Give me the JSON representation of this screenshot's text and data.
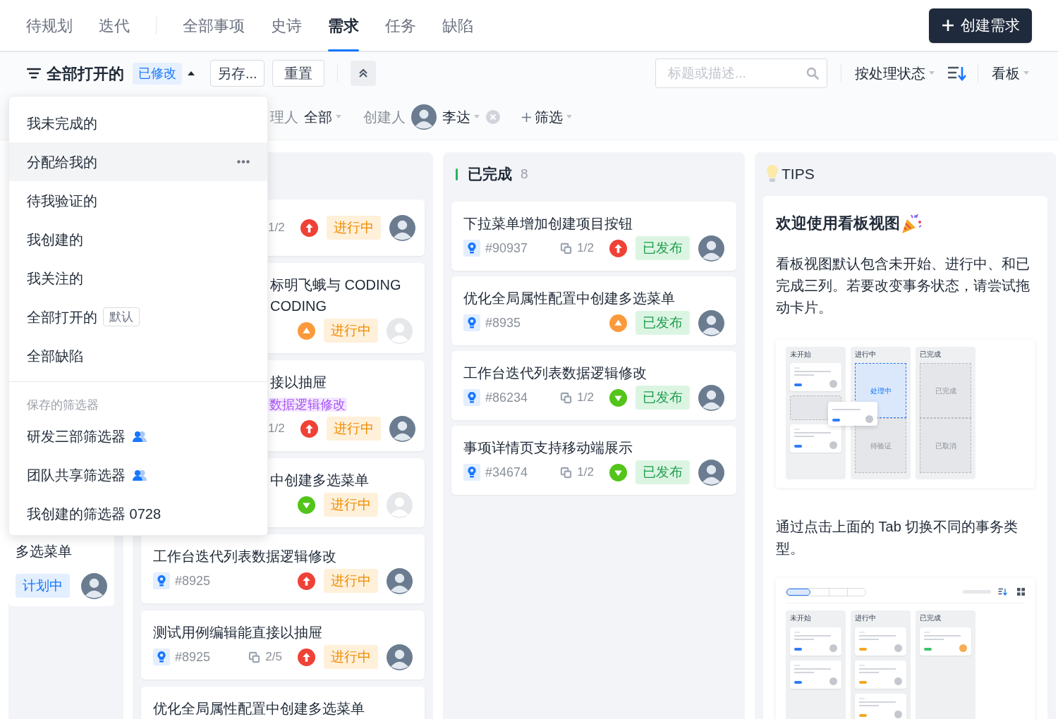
{
  "nav": {
    "tab_groups": [
      [
        {
          "label": "待规划",
          "selected": false
        },
        {
          "label": "迭代",
          "selected": false
        }
      ],
      [
        {
          "label": "全部事项",
          "selected": false
        },
        {
          "label": "史诗",
          "selected": false
        },
        {
          "label": "需求",
          "selected": true
        },
        {
          "label": "任务",
          "selected": false
        },
        {
          "label": "缺陷",
          "selected": false
        }
      ]
    ],
    "create_button": "创建需求"
  },
  "toolbar": {
    "filter_name": "全部打开的",
    "modified_badge": "已修改",
    "save_as": "另存...",
    "reset": "重置",
    "search_placeholder": "标题或描述...",
    "group_by": "按处理状态",
    "view": "看板"
  },
  "filters": [
    {
      "kind": "text",
      "label": "理人",
      "value": "全部"
    },
    {
      "kind": "person",
      "label": "创建人",
      "value": "李达",
      "avatar": {
        "kind": "photo"
      }
    },
    {
      "kind": "add",
      "label": "筛选"
    }
  ],
  "dropdown": {
    "items": [
      {
        "label": "我未完成的",
        "selected": false
      },
      {
        "label": "分配给我的",
        "selected": true
      },
      {
        "label": "待我验证的",
        "selected": false
      },
      {
        "label": "我创建的",
        "selected": false
      },
      {
        "label": "我关注的",
        "selected": false
      },
      {
        "label": "全部打开的",
        "selected": false,
        "tag": "默认"
      },
      {
        "label": "全部缺陷",
        "selected": false
      }
    ],
    "section_title": "保存的筛选器",
    "saved": [
      {
        "label": "研发三部筛选器",
        "shared": true,
        "selected": false
      },
      {
        "label": "团队共享筛选器",
        "shared": true,
        "selected": false
      },
      {
        "label": "我创建的筛选器 0728",
        "shared": false,
        "selected": false
      }
    ]
  },
  "board": {
    "columns": [
      {
        "cards": [
          {
            "title": "多选菜单",
            "status": {
              "label": "计划中",
              "kind": "planned"
            },
            "avatar": {
              "kind": "photo"
            }
          }
        ]
      },
      {
        "cards": [
          {
            "clipped": true,
            "subtasks": "1/2",
            "priority": {
              "kind": "high"
            },
            "status": {
              "label": "进行中",
              "kind": "in_progress"
            },
            "avatar": {
              "kind": "photo"
            }
          },
          {
            "clipped": true,
            "title": "标明飞蛾与 CODING\nCODING",
            "priority": {
              "kind": "medium"
            },
            "status": {
              "label": "进行中",
              "kind": "in_progress"
            },
            "avatar": {
              "kind": "placeholder"
            }
          },
          {
            "clipped": true,
            "title": "接以抽屉",
            "tag": "数据逻辑修改",
            "subtasks": "1/2",
            "priority": {
              "kind": "high"
            },
            "status": {
              "label": "进行中",
              "kind": "in_progress"
            },
            "avatar": {
              "kind": "photo"
            }
          },
          {
            "clipped": true,
            "title": "中创建多选菜单",
            "priority": {
              "kind": "low"
            },
            "status": {
              "label": "进行中",
              "kind": "in_progress"
            },
            "avatar": {
              "kind": "placeholder"
            }
          },
          {
            "clipped": false,
            "title": "工作台迭代列表数据逻辑修改",
            "id": "#8925",
            "priority": {
              "kind": "high"
            },
            "status": {
              "label": "进行中",
              "kind": "in_progress"
            },
            "avatar": {
              "kind": "photo"
            }
          },
          {
            "clipped": false,
            "title": "测试用例编辑能直接以抽屉",
            "id": "#8925",
            "subtasks": "2/5",
            "priority": {
              "kind": "high"
            },
            "status": {
              "label": "进行中",
              "kind": "in_progress"
            },
            "avatar": {
              "kind": "photo"
            }
          },
          {
            "clipped": false,
            "title": "优化全局属性配置中创建多选菜单"
          }
        ]
      },
      {
        "header": {
          "title": "已完成",
          "count": "8"
        },
        "cards": [
          {
            "clipped": false,
            "title": "下拉菜单增加创建项目按钮",
            "id": "#90937",
            "subtasks": "1/2",
            "priority": {
              "kind": "high"
            },
            "status": {
              "label": "已发布",
              "kind": "released"
            },
            "avatar": {
              "kind": "photo"
            }
          },
          {
            "clipped": false,
            "title": "优化全局属性配置中创建多选菜单",
            "id": "#8935",
            "priority": {
              "kind": "medium"
            },
            "status": {
              "label": "已发布",
              "kind": "released"
            },
            "avatar": {
              "kind": "photo"
            }
          },
          {
            "clipped": false,
            "title": "工作台迭代列表数据逻辑修改",
            "id": "#86234",
            "subtasks": "1/2",
            "priority": {
              "kind": "low"
            },
            "status": {
              "label": "已发布",
              "kind": "released"
            },
            "avatar": {
              "kind": "photo"
            }
          },
          {
            "clipped": false,
            "title": "事项详情页支持移动端展示",
            "id": "#34674",
            "subtasks": "1/2",
            "priority": {
              "kind": "low"
            },
            "status": {
              "label": "已发布",
              "kind": "released"
            },
            "avatar": {
              "kind": "photo"
            }
          }
        ]
      }
    ]
  },
  "tips": {
    "title": "TIPS",
    "heading": "欢迎使用看板视图",
    "intro": "看板视图默认包含未开始、进行中、和已完成三列。若要改变事务状态，请尝试拖动卡片。",
    "drag_demo": {
      "columns": [
        {
          "label": "未开始",
          "kind": "cards"
        },
        {
          "label": "进行中",
          "kind": "zones",
          "zones": [
            {
              "label": "处理中",
              "selected": true
            },
            {
              "label": "待验证",
              "selected": false
            }
          ]
        },
        {
          "label": "已完成",
          "kind": "zones",
          "zones": [
            {
              "label": "已完成",
              "selected": false
            },
            {
              "label": "已取消",
              "selected": false
            }
          ]
        }
      ]
    },
    "tab_hint": "通过点击上面的 Tab 切换不同的事务类型。",
    "tab_demo": {
      "columns": [
        {
          "label": "未开始",
          "cards": [
            {
              "color": "#2f7bf6"
            },
            {
              "color": "#2f7bf6"
            }
          ]
        },
        {
          "label": "进行中",
          "cards": [
            {
              "color": "#f5a623"
            },
            {
              "color": "#f5a623"
            },
            {
              "color": "#f5a623"
            }
          ]
        },
        {
          "label": "已完成",
          "cards": [
            {
              "color": "#3cc46a"
            }
          ]
        }
      ]
    }
  }
}
